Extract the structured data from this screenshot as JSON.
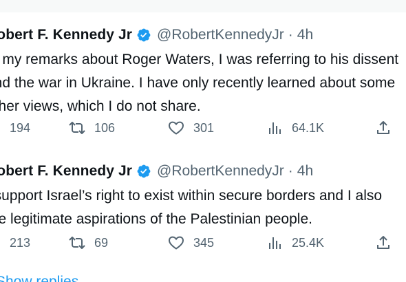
{
  "tweets": [
    {
      "author_name": "Robert F. Kennedy Jr",
      "handle": "@RobertKennedyJr",
      "separator": "·",
      "time": "4h",
      "lines": [
        "In my remarks about Roger Waters, I was referring to his dissent",
        "and the war in Ukraine. I have only recently learned about some",
        "other views, which I do not share."
      ],
      "replies": "194",
      "retweets": "106",
      "likes": "301",
      "views": "64.1K"
    },
    {
      "author_name": "Robert F. Kennedy Jr",
      "handle": "@RobertKennedyJr",
      "separator": "·",
      "time": "4h",
      "lines": [
        "I support Israel’s right to exist within secure borders and I also",
        "the legitimate aspirations of the Palestinian people."
      ],
      "replies": "213",
      "retweets": "69",
      "likes": "345",
      "views": "25.4K"
    }
  ],
  "show_replies_label": "Show replies",
  "colors": {
    "text": "#0f1419",
    "secondary": "#536471",
    "verified": "#1d9bf0",
    "link": "#1d9bf0"
  },
  "icons": [
    "verified-badge-icon",
    "reply-icon",
    "retweet-icon",
    "like-icon",
    "views-icon",
    "share-icon"
  ]
}
